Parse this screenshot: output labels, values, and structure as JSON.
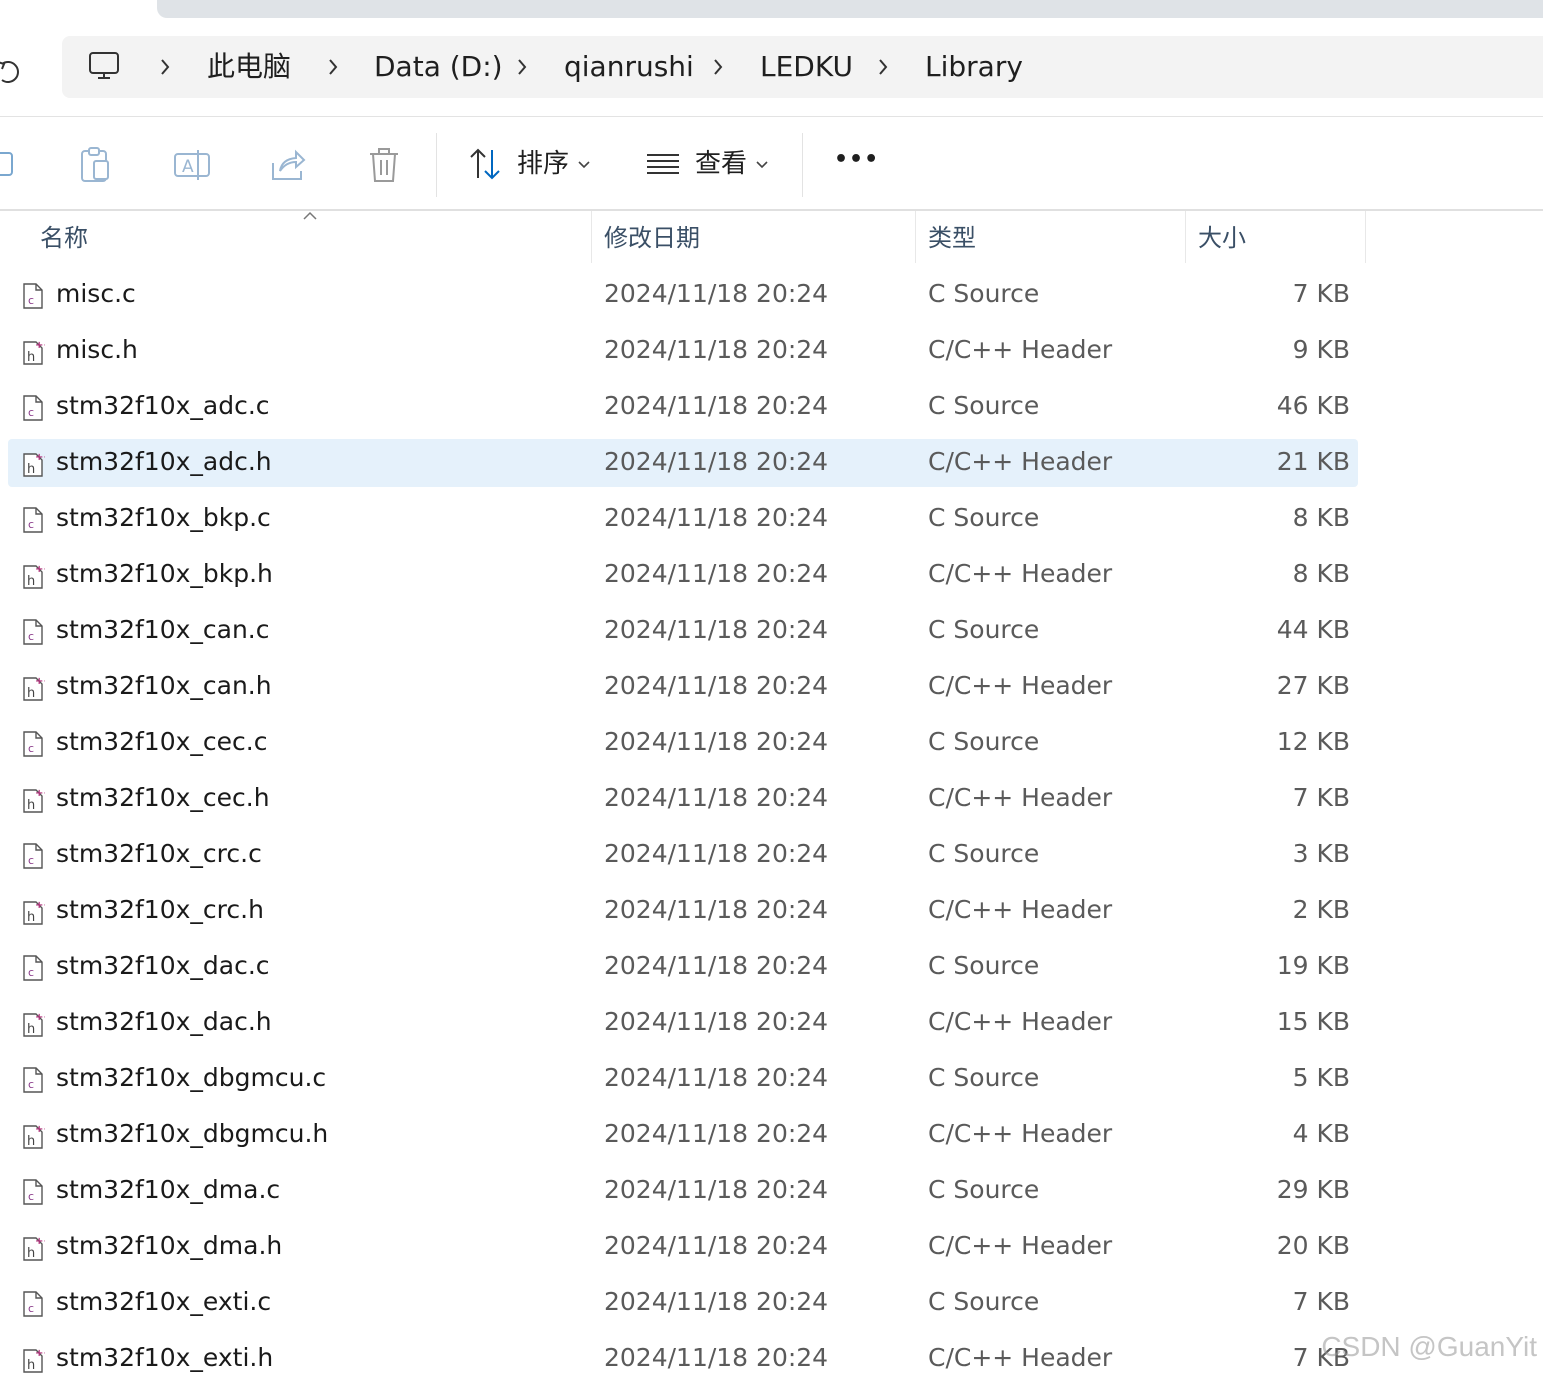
{
  "breadcrumb": {
    "items": [
      "此电脑",
      "Data (D:)",
      "qianrushi",
      "LEDKU",
      "Library"
    ]
  },
  "toolbar": {
    "sort_label": "排序",
    "view_label": "查看",
    "more_label": "•••"
  },
  "columns": {
    "name": "名称",
    "modified": "修改日期",
    "type": "类型",
    "size": "大小"
  },
  "files": [
    {
      "name": "misc.c",
      "date": "2024/11/18 20:24",
      "type": "C Source",
      "size": "7 KB",
      "kind": "c"
    },
    {
      "name": "misc.h",
      "date": "2024/11/18 20:24",
      "type": "C/C++ Header",
      "size": "9 KB",
      "kind": "h"
    },
    {
      "name": "stm32f10x_adc.c",
      "date": "2024/11/18 20:24",
      "type": "C Source",
      "size": "46 KB",
      "kind": "c"
    },
    {
      "name": "stm32f10x_adc.h",
      "date": "2024/11/18 20:24",
      "type": "C/C++ Header",
      "size": "21 KB",
      "kind": "h",
      "selected": true
    },
    {
      "name": "stm32f10x_bkp.c",
      "date": "2024/11/18 20:24",
      "type": "C Source",
      "size": "8 KB",
      "kind": "c"
    },
    {
      "name": "stm32f10x_bkp.h",
      "date": "2024/11/18 20:24",
      "type": "C/C++ Header",
      "size": "8 KB",
      "kind": "h"
    },
    {
      "name": "stm32f10x_can.c",
      "date": "2024/11/18 20:24",
      "type": "C Source",
      "size": "44 KB",
      "kind": "c"
    },
    {
      "name": "stm32f10x_can.h",
      "date": "2024/11/18 20:24",
      "type": "C/C++ Header",
      "size": "27 KB",
      "kind": "h"
    },
    {
      "name": "stm32f10x_cec.c",
      "date": "2024/11/18 20:24",
      "type": "C Source",
      "size": "12 KB",
      "kind": "c"
    },
    {
      "name": "stm32f10x_cec.h",
      "date": "2024/11/18 20:24",
      "type": "C/C++ Header",
      "size": "7 KB",
      "kind": "h"
    },
    {
      "name": "stm32f10x_crc.c",
      "date": "2024/11/18 20:24",
      "type": "C Source",
      "size": "3 KB",
      "kind": "c"
    },
    {
      "name": "stm32f10x_crc.h",
      "date": "2024/11/18 20:24",
      "type": "C/C++ Header",
      "size": "2 KB",
      "kind": "h"
    },
    {
      "name": "stm32f10x_dac.c",
      "date": "2024/11/18 20:24",
      "type": "C Source",
      "size": "19 KB",
      "kind": "c"
    },
    {
      "name": "stm32f10x_dac.h",
      "date": "2024/11/18 20:24",
      "type": "C/C++ Header",
      "size": "15 KB",
      "kind": "h"
    },
    {
      "name": "stm32f10x_dbgmcu.c",
      "date": "2024/11/18 20:24",
      "type": "C Source",
      "size": "5 KB",
      "kind": "c"
    },
    {
      "name": "stm32f10x_dbgmcu.h",
      "date": "2024/11/18 20:24",
      "type": "C/C++ Header",
      "size": "4 KB",
      "kind": "h"
    },
    {
      "name": "stm32f10x_dma.c",
      "date": "2024/11/18 20:24",
      "type": "C Source",
      "size": "29 KB",
      "kind": "c"
    },
    {
      "name": "stm32f10x_dma.h",
      "date": "2024/11/18 20:24",
      "type": "C/C++ Header",
      "size": "20 KB",
      "kind": "h"
    },
    {
      "name": "stm32f10x_exti.c",
      "date": "2024/11/18 20:24",
      "type": "C Source",
      "size": "7 KB",
      "kind": "c"
    },
    {
      "name": "stm32f10x_exti.h",
      "date": "2024/11/18 20:24",
      "type": "C/C++ Header",
      "size": "7 KB",
      "kind": "h"
    }
  ],
  "icons": {
    "c_file": "c-source-file-icon",
    "h_file": "header-file-icon",
    "accent": "#0067c0",
    "selection": "#e5f1fb"
  },
  "watermark": "CSDN @GuanYit"
}
